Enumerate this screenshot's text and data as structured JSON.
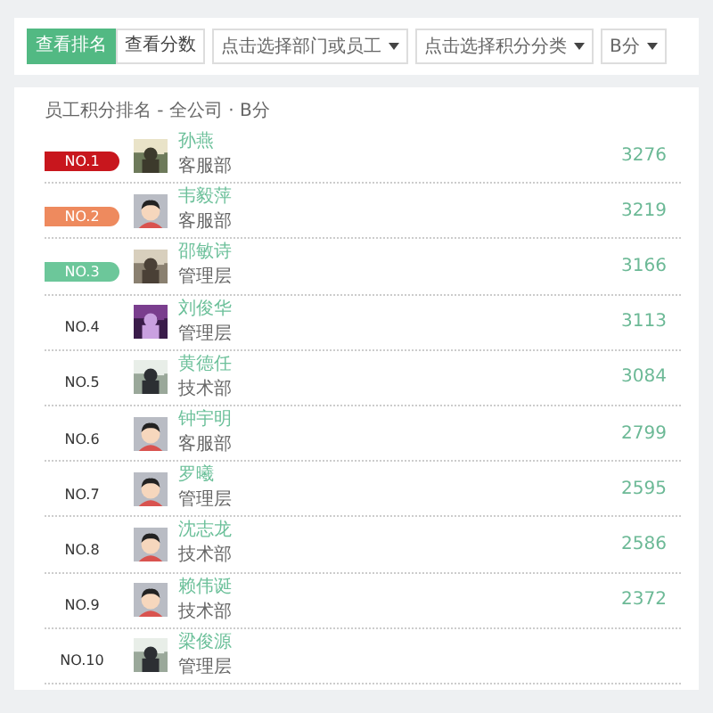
{
  "toolbar": {
    "tabs": [
      {
        "label": "查看排名",
        "selected": true
      },
      {
        "label": "查看分数",
        "selected": false
      }
    ],
    "dropdowns": [
      {
        "value": "点击选择部门或员工"
      },
      {
        "value": "点击选择积分分类"
      },
      {
        "value": "B分"
      }
    ]
  },
  "ranking": {
    "title": "员工积分排名 - 全公司 · B分",
    "rows": [
      {
        "rank": "NO.1",
        "color": "#c8161d",
        "name": "孙燕",
        "department": "客服部",
        "score": "3276"
      },
      {
        "rank": "NO.2",
        "color": "#ee8a5e",
        "kind": "default",
        "name": "韦毅萍",
        "department": "客服部",
        "score": "3219"
      },
      {
        "rank": "NO.3",
        "color": "#6cc79a",
        "name": "邵敏诗",
        "department": "管理层",
        "score": "3166"
      },
      {
        "rank": "NO.4",
        "name": "刘俊华",
        "department": "管理层",
        "score": "3113"
      },
      {
        "rank": "NO.5",
        "name": "黄德任",
        "department": "技术部",
        "score": "3084"
      },
      {
        "rank": "NO.6",
        "kind": "default",
        "name": "钟宇明",
        "department": "客服部",
        "score": "2799"
      },
      {
        "rank": "NO.7",
        "kind": "default",
        "name": "罗曦",
        "department": "管理层",
        "score": "2595"
      },
      {
        "rank": "NO.8",
        "kind": "default",
        "name": "沈志龙",
        "department": "技术部",
        "score": "2586"
      },
      {
        "rank": "NO.9",
        "kind": "default",
        "name": "赖伟诞",
        "department": "技术部",
        "score": "2372"
      },
      {
        "rank": "NO.10",
        "name": "梁俊源",
        "department": "管理层"
      }
    ]
  }
}
